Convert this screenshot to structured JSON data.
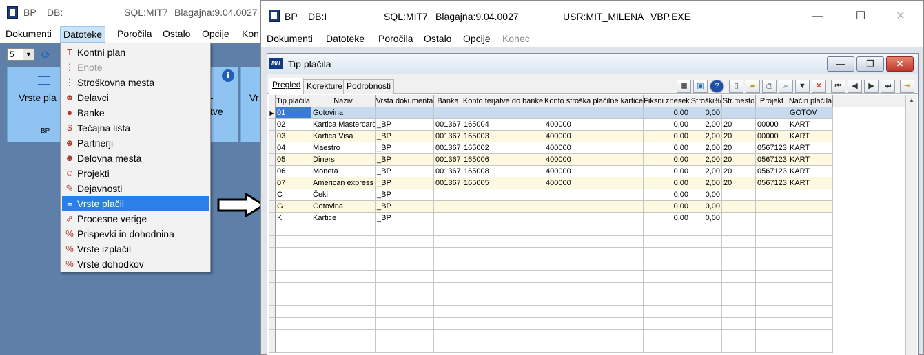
{
  "bg_window": {
    "title": "BP",
    "db_label": "DB:",
    "sql": "SQL:MIT7",
    "blagajna": "Blagajna:9.04.0027",
    "menu": [
      "Dokumenti",
      "Datoteke",
      "Poročila",
      "Ostalo",
      "Opcije",
      "Kon"
    ],
    "combo_value": "5",
    "tiles": [
      {
        "title": "Vrste pla",
        "sub": "BP"
      },
      {
        "title": "- ",
        "sub2": "tve"
      },
      {
        "title": "Vr"
      }
    ]
  },
  "dropdown": {
    "items": [
      {
        "label": "Kontni plan",
        "icon": "text-format-icon",
        "glyph": "T"
      },
      {
        "label": "Enote",
        "icon": "tree-icon",
        "glyph": "⋮",
        "disabled": true
      },
      {
        "label": "Stroškovna mesta",
        "icon": "tree-icon",
        "glyph": "⋮"
      },
      {
        "label": "Delavci",
        "icon": "people-icon",
        "glyph": "☻"
      },
      {
        "label": "Banke",
        "icon": "money-bag-icon",
        "glyph": "●"
      },
      {
        "label": "Tečajna lista",
        "icon": "dollar-icon",
        "glyph": "$"
      },
      {
        "label": "Partnerji",
        "icon": "people-icon",
        "glyph": "☻"
      },
      {
        "label": "Delovna mesta",
        "icon": "people-icon",
        "glyph": "☻"
      },
      {
        "label": "Projekti",
        "icon": "group-icon",
        "glyph": "☺"
      },
      {
        "label": "Dejavnosti",
        "icon": "tools-icon",
        "glyph": "✎"
      },
      {
        "label": "Vrste plačil",
        "icon": "list-icon",
        "glyph": "≡",
        "selected": true
      },
      {
        "label": "Procesne verige",
        "icon": "process-icon",
        "glyph": "⇗"
      },
      {
        "label": "Prispevki in dohodnina",
        "icon": "percent-icon",
        "glyph": "%"
      },
      {
        "label": "Vrste izplačil",
        "icon": "percent-icon",
        "glyph": "%"
      },
      {
        "label": "Vrste dohodkov",
        "icon": "percent-icon",
        "glyph": "%"
      }
    ]
  },
  "fg_window": {
    "title": "BP",
    "db_label": "DB:I",
    "sql": "SQL:MIT7",
    "blagajna": "Blagajna:9.04.0027",
    "user": "USR:MIT_MILENA",
    "exe": "VBP.EXE",
    "controls": {
      "minimize": "—",
      "maximize": "☐",
      "close": "✕"
    },
    "menu": [
      "Dokumenti",
      "Datoteke",
      "Poročila",
      "Ostalo",
      "Opcije",
      "Konec"
    ]
  },
  "child": {
    "logo": "MIT",
    "title": "Tip plačila",
    "tabs": [
      "Pregled",
      "Korekture",
      "Podrobnosti"
    ],
    "grid": {
      "columns": [
        "Tip plačila",
        "Naziv",
        "Vrsta dokumenta",
        "Banka",
        "Konto terjatve do banke",
        "Konto stroška plačilne kartice",
        "Fiksni znesek",
        "Stroški%",
        "Str.mesto",
        "Projekt",
        "Način plačila"
      ],
      "rows": [
        [
          "01",
          "Gotovina",
          "",
          "",
          "",
          "",
          "0,00",
          "0,00",
          "",
          "",
          "GOTOV"
        ],
        [
          "02",
          "Kartica Mastercard",
          "_BP",
          "001367",
          "165004",
          "400000",
          "0,00",
          "2,00",
          "20",
          "00000",
          "KART"
        ],
        [
          "03",
          "Kartica Visa",
          "_BP",
          "001367",
          "165003",
          "400000",
          "0,00",
          "2,00",
          "20",
          "00000",
          "KART"
        ],
        [
          "04",
          "Maestro",
          "_BP",
          "001367",
          "165002",
          "400000",
          "0,00",
          "2,00",
          "20",
          "0567123",
          "KART"
        ],
        [
          "05",
          "Diners",
          "_BP",
          "001367",
          "165006",
          "400000",
          "0,00",
          "2,00",
          "20",
          "0567123",
          "KART"
        ],
        [
          "06",
          "Moneta",
          "_BP",
          "001367",
          "165008",
          "400000",
          "0,00",
          "2,00",
          "20",
          "0567123",
          "KART"
        ],
        [
          "07",
          "American express",
          "_BP",
          "001367",
          "165005",
          "400000",
          "0,00",
          "2,00",
          "20",
          "0567123",
          "KART"
        ],
        [
          "C",
          "Čeki",
          "_BP",
          "",
          "",
          "",
          "0,00",
          "0,00",
          "",
          "",
          ""
        ],
        [
          "G",
          "Gotovina",
          "_BP",
          "",
          "",
          "",
          "0,00",
          "0,00",
          "",
          "",
          ""
        ],
        [
          "K",
          "Kartice",
          "_BP",
          "",
          "",
          "",
          "0,00",
          "0,00",
          "",
          "",
          ""
        ]
      ]
    }
  },
  "colors": {
    "accent": "#2b7fe8",
    "desktop": "#5e7fa8",
    "tile": "#8fc3f2",
    "row_alt": "#fdf8e0",
    "row_selected": "#c8dbee"
  }
}
